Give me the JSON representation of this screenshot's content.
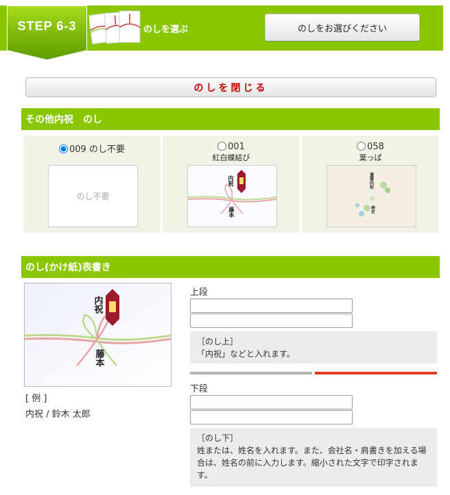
{
  "header": {
    "step": "STEP 6-3",
    "title": "のしを選ぶ",
    "choose_button": "のしをお選びください"
  },
  "close_button": "のしを閉じる",
  "section1": {
    "title": "その他内祝　のし",
    "options": [
      {
        "label": "009 のし不要",
        "sub": "",
        "image_text": "のし不要",
        "selected": true
      },
      {
        "label": "001",
        "sub": "紅白蝶結び",
        "selected": false
      },
      {
        "label": "058",
        "sub": "葉っぱ",
        "selected": false
      }
    ]
  },
  "section2": {
    "title": "のし(かけ紙)表書き",
    "example_label": "[ 例 ]",
    "example_value": "内祝 / 鈴木 太郎",
    "upper_label": "上段",
    "upper_note_title": "［のし上］",
    "upper_note_text": "「内祝」などと入れます。",
    "lower_label": "下段",
    "lower_note_title": "［のし下］",
    "lower_note_text": "姓または、姓名を入れます。また、会社名・肩書きを加える場合は、姓名の前に入力します。縮小された文字で印字されます。"
  },
  "noshi_image": {
    "upper_text": "内祝",
    "lower_text": "藤本"
  },
  "leaf_image": {
    "upper_text": "還暦内祝",
    "lower_text": "崇史"
  },
  "colors": {
    "accent": "#8ac700",
    "close_text": "#c40000",
    "red_bar": "#e04020"
  }
}
